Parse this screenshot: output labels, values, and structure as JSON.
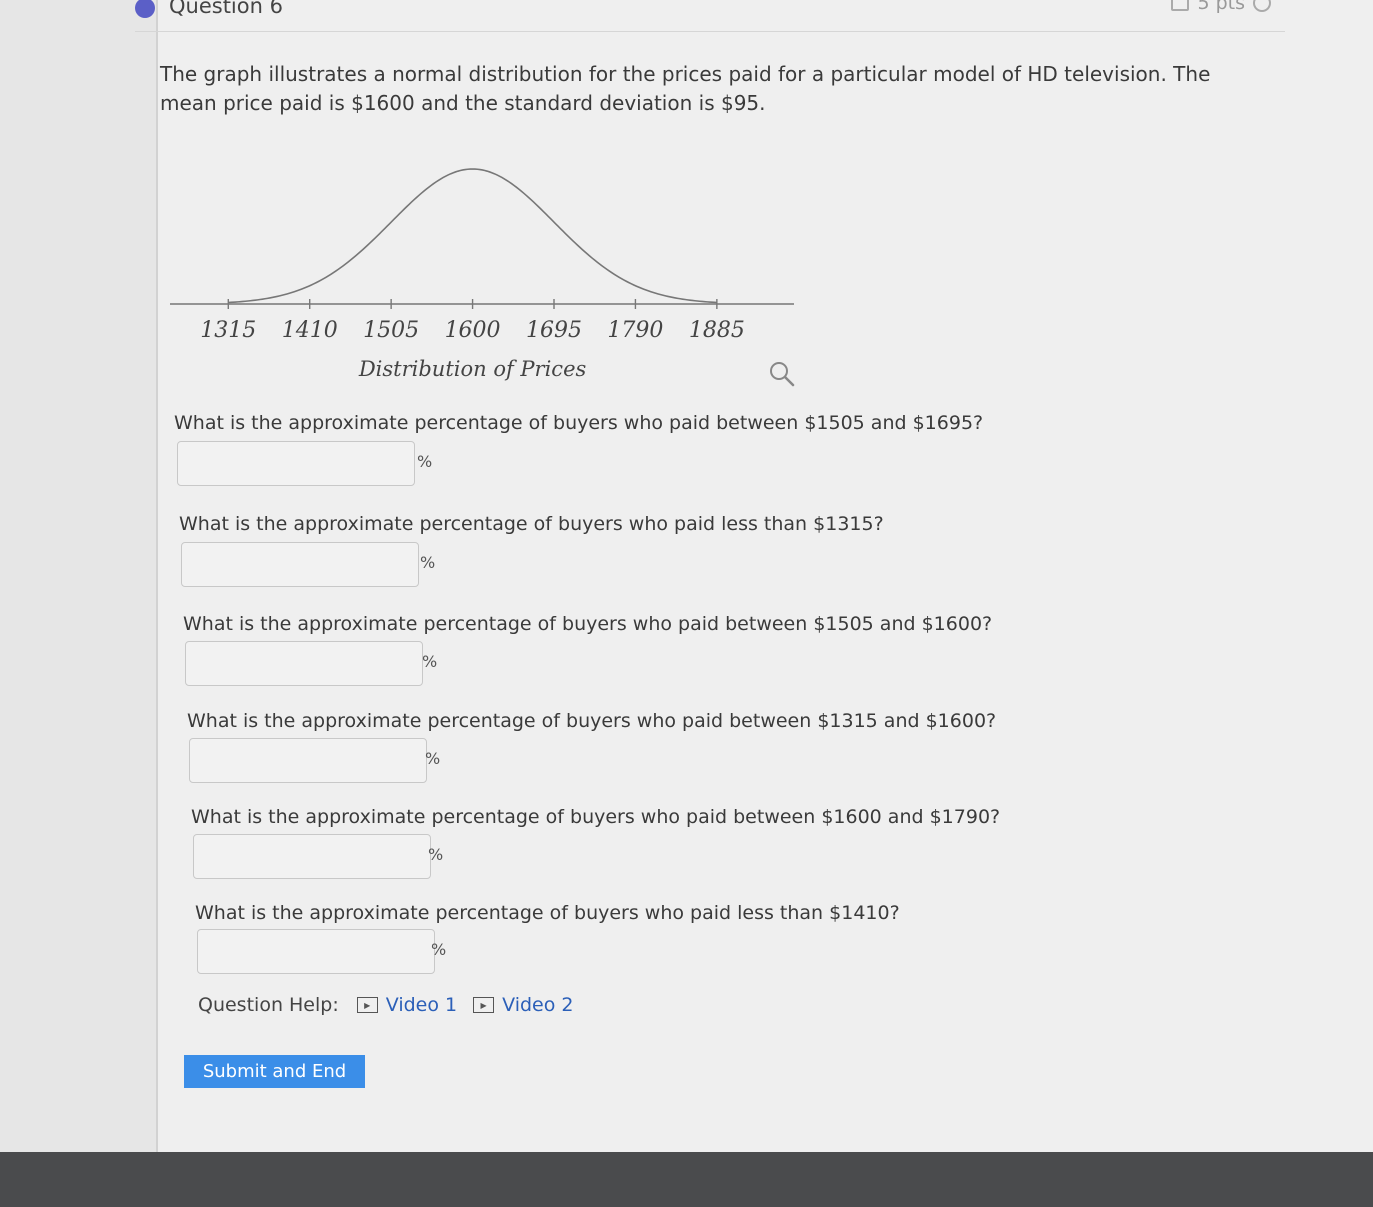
{
  "header": {
    "title": "Question 6",
    "points": "5 pts"
  },
  "intro": "The graph illustrates a normal distribution for the prices paid for a particular model of HD television. The mean price paid is $1600 and the standard deviation is $95.",
  "chart_data": {
    "type": "line",
    "title": "",
    "xlabel": "Distribution of Prices",
    "ylabel": "",
    "mean": 1600,
    "std": 95,
    "x_ticks": [
      1315,
      1410,
      1505,
      1600,
      1695,
      1790,
      1885
    ],
    "xlim": [
      1247,
      1975
    ],
    "grid": false
  },
  "questions": [
    {
      "text": "What is the approximate percentage of buyers who paid between $1505 and $1695?",
      "unit": "%",
      "value": ""
    },
    {
      "text": "What is the approximate percentage of buyers who paid less than $1315?",
      "unit": "%",
      "value": ""
    },
    {
      "text": "What is the approximate percentage of buyers who paid between $1505 and $1600?",
      "unit": "%",
      "value": ""
    },
    {
      "text": "What is the approximate percentage of buyers who paid between $1315 and $1600?",
      "unit": "%",
      "value": ""
    },
    {
      "text": "What is the approximate percentage of buyers who paid between $1600 and $1790?",
      "unit": "%",
      "value": ""
    },
    {
      "text": "What is the approximate percentage of buyers who paid less than $1410?",
      "unit": "%",
      "value": ""
    }
  ],
  "help": {
    "label": "Question Help:",
    "links": [
      "Video 1",
      "Video 2"
    ]
  },
  "submit_label": "Submit and End",
  "icons": [
    "zoom-icon",
    "play-video-icon",
    "points-icon",
    "retry-icon"
  ],
  "colors": {
    "accent": "#5b5fc7",
    "link": "#2b5fb8",
    "button": "#3b8ee8"
  }
}
